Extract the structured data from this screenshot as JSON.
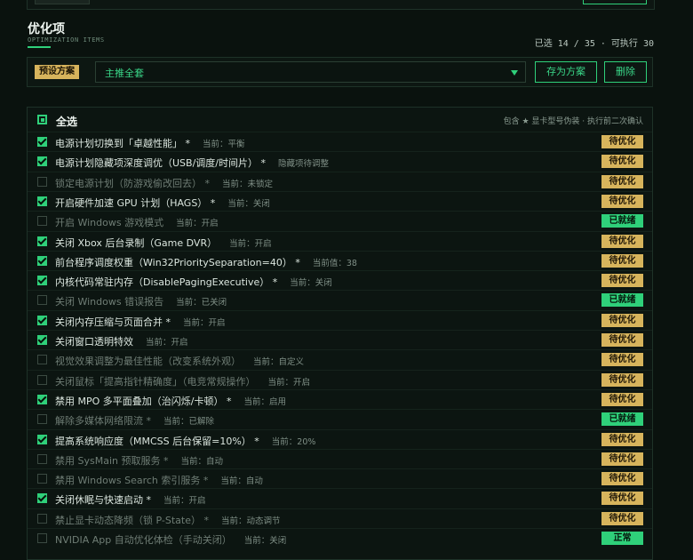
{
  "section": {
    "title": "优化项",
    "subtitle": "OPTIMIZATION ITEMS",
    "stats": "已选 14 / 35 · 可执行 30"
  },
  "preset": {
    "tag": "预设方案",
    "selected": "主推全套",
    "save_label": "存为方案",
    "delete_label": "删除"
  },
  "list": {
    "select_all": "全选",
    "note": "包含 ★ 显卡型号伪装 · 执行前二次确认"
  },
  "colors": {
    "accent": "#2fd07a",
    "pending": "#d7b45c",
    "background": "#0a120e"
  },
  "items": [
    {
      "name": "电源计划切换到「卓越性能」 *",
      "current": "当前：平衡",
      "checked": true,
      "status": "待优化",
      "state": "pending"
    },
    {
      "name": "电源计划隐藏项深度调优（USB/调度/时间片） *",
      "current": "隐藏项待调整",
      "checked": true,
      "status": "待优化",
      "state": "pending"
    },
    {
      "name": "锁定电源计划（防游戏偷改回去） *",
      "current": "当前：未锁定",
      "checked": false,
      "status": "待优化",
      "state": "pending"
    },
    {
      "name": "开启硬件加速 GPU 计划（HAGS） *",
      "current": "当前：关闭",
      "checked": true,
      "status": "待优化",
      "state": "pending"
    },
    {
      "name": "开启 Windows 游戏模式",
      "current": "当前：开启",
      "checked": false,
      "status": "已就绪",
      "state": "ready"
    },
    {
      "name": "关闭 Xbox 后台录制（Game DVR）",
      "current": "当前：开启",
      "checked": true,
      "status": "待优化",
      "state": "pending"
    },
    {
      "name": "前台程序调度权重（Win32PrioritySeparation=40） *",
      "current": "当前值：38",
      "checked": true,
      "status": "待优化",
      "state": "pending"
    },
    {
      "name": "内核代码常驻内存（DisablePagingExecutive） *",
      "current": "当前：关闭",
      "checked": true,
      "status": "待优化",
      "state": "pending"
    },
    {
      "name": "关闭 Windows 错误报告",
      "current": "当前：已关闭",
      "checked": false,
      "status": "已就绪",
      "state": "ready"
    },
    {
      "name": "关闭内存压缩与页面合并 *",
      "current": "当前：开启",
      "checked": true,
      "status": "待优化",
      "state": "pending"
    },
    {
      "name": "关闭窗口透明特效",
      "current": "当前：开启",
      "checked": true,
      "status": "待优化",
      "state": "pending"
    },
    {
      "name": "视觉效果调整为最佳性能（改变系统外观）",
      "current": "当前：自定义",
      "checked": false,
      "status": "待优化",
      "state": "pending"
    },
    {
      "name": "关闭鼠标「提高指针精确度」（电竞常规操作）",
      "current": "当前：开启",
      "checked": false,
      "status": "待优化",
      "state": "pending"
    },
    {
      "name": "禁用 MPO 多平面叠加（治闪烁/卡顿） *",
      "current": "当前：启用",
      "checked": true,
      "status": "待优化",
      "state": "pending"
    },
    {
      "name": "解除多媒体网络限流 *",
      "current": "当前：已解除",
      "checked": false,
      "status": "已就绪",
      "state": "ready"
    },
    {
      "name": "提高系统响应度（MMCSS 后台保留=10%） *",
      "current": "当前：20%",
      "checked": true,
      "status": "待优化",
      "state": "pending"
    },
    {
      "name": "禁用 SysMain 预取服务 *",
      "current": "当前：自动",
      "checked": false,
      "status": "待优化",
      "state": "pending"
    },
    {
      "name": "禁用 Windows Search 索引服务 *",
      "current": "当前：自动",
      "checked": false,
      "status": "待优化",
      "state": "pending"
    },
    {
      "name": "关闭休眠与快速启动 *",
      "current": "当前：开启",
      "checked": true,
      "status": "待优化",
      "state": "pending"
    },
    {
      "name": "禁止显卡动态降频（锁 P-State） *",
      "current": "当前：动态调节",
      "checked": false,
      "status": "待优化",
      "state": "pending"
    },
    {
      "name": "NVIDIA App 自动优化体检（手动关闭）",
      "current": "当前：关闭",
      "checked": false,
      "status": "正常",
      "state": "ready"
    }
  ]
}
